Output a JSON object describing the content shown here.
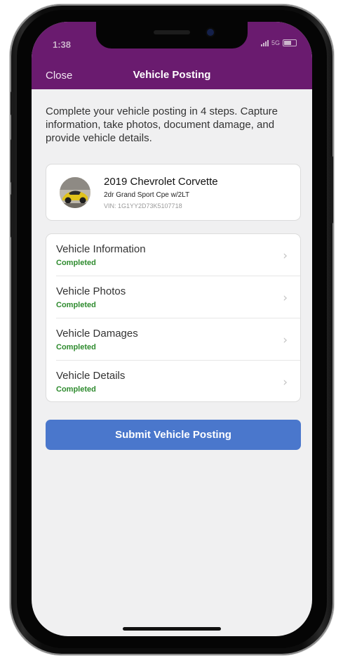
{
  "status_bar": {
    "time": "1:38",
    "network": "5G"
  },
  "nav": {
    "close_label": "Close",
    "title": "Vehicle Posting"
  },
  "intro_text": "Complete your vehicle posting in 4 steps. Capture information, take photos, document damage, and provide vehicle details.",
  "vehicle": {
    "name": "2019 Chevrolet Corvette",
    "trim": "2dr Grand Sport Cpe w/2LT",
    "vin": "VIN: 1G1YY2D73K5107718"
  },
  "steps": [
    {
      "label": "Vehicle Information",
      "status": "Completed"
    },
    {
      "label": "Vehicle Photos",
      "status": "Completed"
    },
    {
      "label": "Vehicle Damages",
      "status": "Completed"
    },
    {
      "label": "Vehicle Details",
      "status": "Completed"
    }
  ],
  "submit_label": "Submit Vehicle Posting",
  "colors": {
    "header": "#6a1b6f",
    "accent": "#4a77cc",
    "completed": "#2e8b2e"
  },
  "icons": {
    "chevron": "chevron-right-icon",
    "vehicle": "vehicle-thumbnail"
  }
}
